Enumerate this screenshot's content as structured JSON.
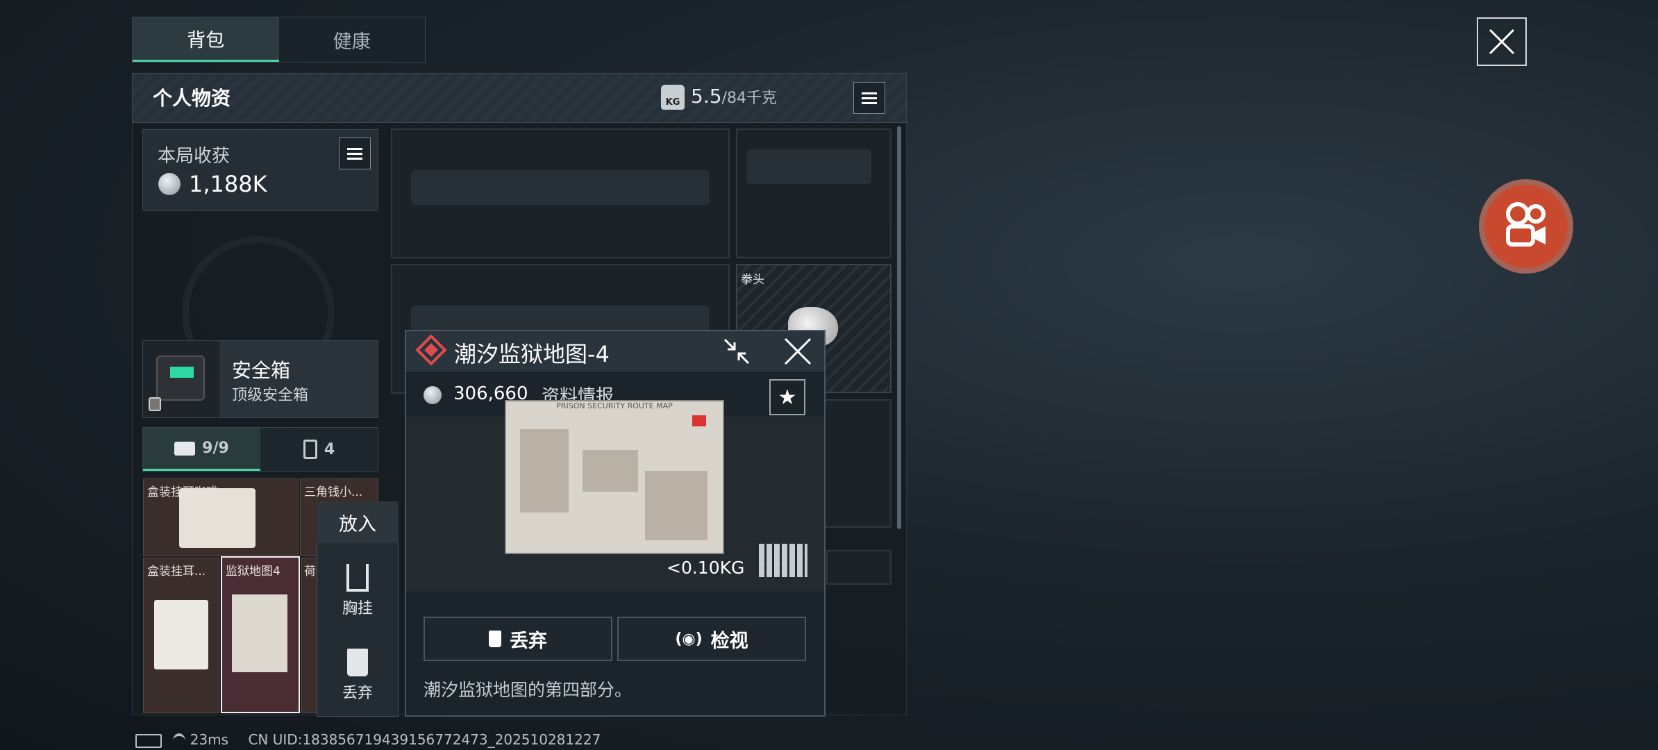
{
  "top_tabs": [
    {
      "label": "背包",
      "active": true
    },
    {
      "label": "健康",
      "active": false
    }
  ],
  "panel": {
    "title": "个人物资",
    "weight_current": "5.5",
    "weight_max": "/84千克",
    "weight_icon_label": "KG"
  },
  "harvest": {
    "label": "本局收获",
    "value": "1,188K"
  },
  "safe_box": {
    "title": "安全箱",
    "subtitle": "顶级安全箱"
  },
  "sub_tabs": [
    {
      "label": "9/9",
      "icon": "toolbox-icon",
      "active": true
    },
    {
      "label": "4",
      "icon": "backpack-icon",
      "active": false
    }
  ],
  "inventory": [
    {
      "label": "盒装挂耳咖啡"
    },
    {
      "label": "三角钱小..."
    },
    {
      "label": "盒装挂耳..."
    },
    {
      "label": "监狱地图4"
    },
    {
      "label": "荷"
    }
  ],
  "fist_slot": {
    "label": "拳头"
  },
  "context_menu": {
    "put_in": "放入",
    "chest_rig": "胸挂",
    "discard": "丢弃"
  },
  "popup": {
    "title": "潮汐监狱地图-4",
    "value": "306,660",
    "type": "资料情报",
    "map_title": "PRISON SECURITY ROUTE MAP",
    "weight": "<0.10KG",
    "discard": "丢弃",
    "inspect": "检视",
    "description": "潮汐监狱地图的第四部分。"
  },
  "status": {
    "ping": "23ms",
    "uid": "CN UID:18385671943915677247​3_202510281227"
  },
  "colors": {
    "accent": "#4fd1a1",
    "rarity": "#e04b4b",
    "record_button": "#c9492e"
  }
}
